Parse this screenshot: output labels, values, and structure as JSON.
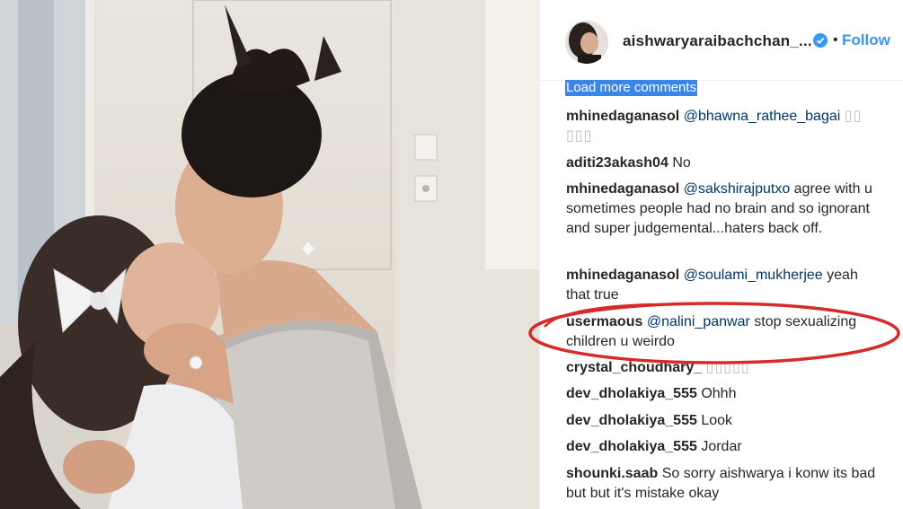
{
  "post": {
    "author": "aishwaryaraibachchan_...",
    "follow_dot": "•",
    "follow_label": "Follow",
    "load_more_label": "Load more comments"
  },
  "comments": [
    {
      "user": "mhinedaganasol",
      "mention": "@bhawna_rathee_bagai",
      "text": "",
      "extra": "▯▯ ▯▯▯"
    },
    {
      "user": "aditi23akash04",
      "mention": "",
      "text": "No",
      "extra": ""
    },
    {
      "user": "mhinedaganasol",
      "mention": "@sakshirajputxo",
      "text": "agree with u sometimes people had no brain and so ignorant and super judgemental...haters back off.",
      "extra": ""
    },
    {
      "user": "mhinedaganasol",
      "mention": "@soulami_mukherjee",
      "text": "yeah that true",
      "extra": ""
    },
    {
      "user": "usermaous",
      "mention": "@nalini_panwar",
      "text": "stop sexualizing children u weirdo",
      "extra": ""
    },
    {
      "user": "crystal_choudhary_",
      "mention": "",
      "text": "",
      "extra": "▯▯▯▯▯"
    },
    {
      "user": "dev_dholakiya_555",
      "mention": "",
      "text": "Ohhh",
      "extra": ""
    },
    {
      "user": "dev_dholakiya_555",
      "mention": "",
      "text": "Look",
      "extra": ""
    },
    {
      "user": "dev_dholakiya_555",
      "mention": "",
      "text": "Jordar",
      "extra": ""
    },
    {
      "user": "shounki.saab",
      "mention": "",
      "text": "So sorry aishwarya i konw its bad but but it's mistake okay",
      "extra": ""
    }
  ],
  "colors": {
    "link": "#3897f0",
    "mention": "#003569",
    "highlight_ring": "#d92a2a",
    "selection": "#3a86e8"
  },
  "icons": {
    "verified": "verified-badge-icon",
    "avatar": "profile-avatar"
  }
}
